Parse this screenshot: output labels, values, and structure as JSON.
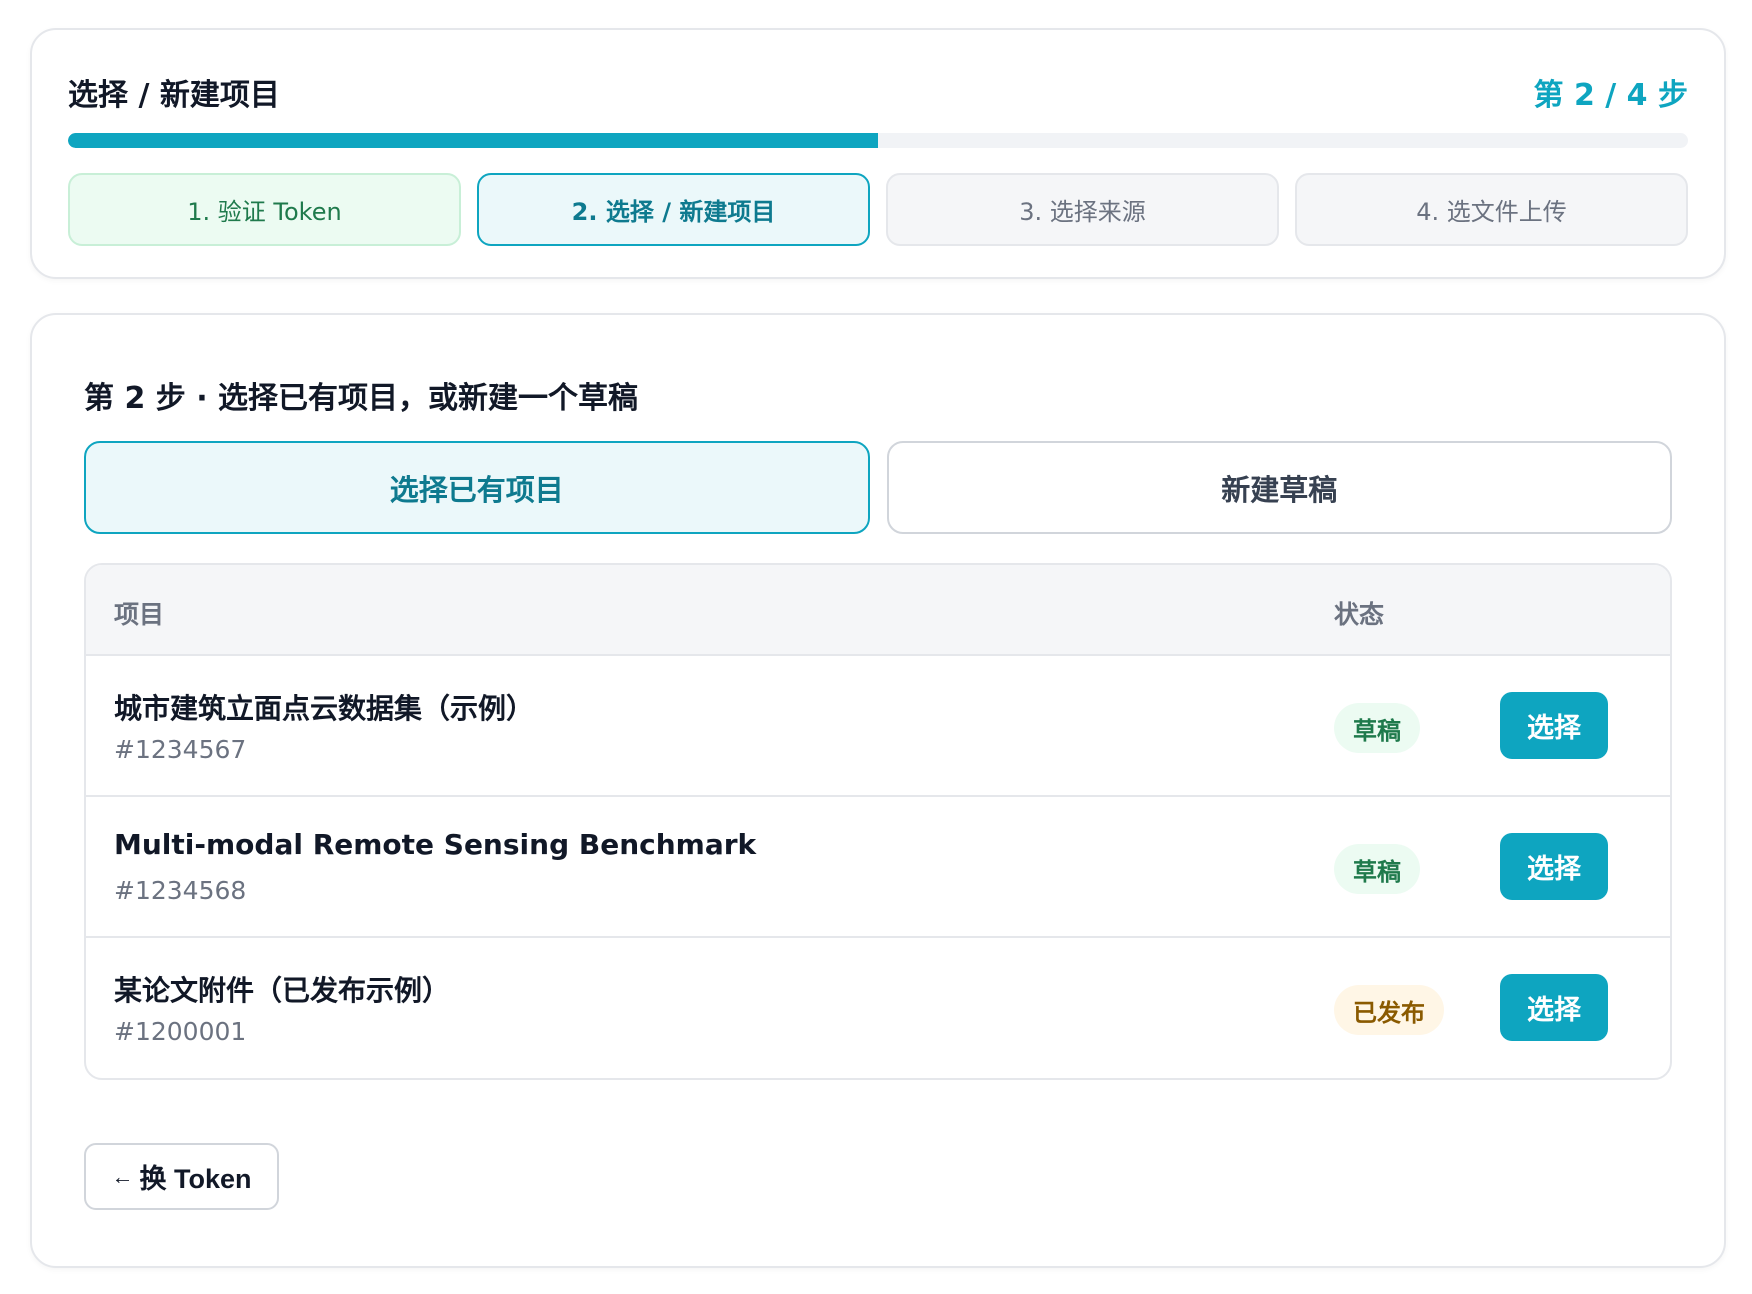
{
  "progress": {
    "title": "选择 / 新建项目",
    "step_indicator": "第 2 / 4 步",
    "fraction": 0.5,
    "steps": [
      {
        "label": "1. 验证 Token",
        "state": "done"
      },
      {
        "label": "2. 选择 / 新建项目",
        "state": "active"
      },
      {
        "label": "3. 选择来源",
        "state": "pending"
      },
      {
        "label": "4. 选文件上传",
        "state": "pending"
      }
    ]
  },
  "main": {
    "heading": "第 2 步 · 选择已有项目，或新建一个草稿",
    "tabs": [
      {
        "label": "选择已有项目",
        "active": true
      },
      {
        "label": "新建草稿",
        "active": false
      }
    ],
    "table": {
      "headers": {
        "name": "项目",
        "status": "状态"
      },
      "rows": [
        {
          "name": "城市建筑立面点云数据集（示例）",
          "id": "#1234567",
          "status": "草稿",
          "status_type": "draft",
          "action": "选择"
        },
        {
          "name": "Multi-modal Remote Sensing Benchmark",
          "id": "#1234568",
          "status": "草稿",
          "status_type": "draft",
          "action": "选择"
        },
        {
          "name": "某论文附件（已发布示例）",
          "id": "#1200001",
          "status": "已发布",
          "status_type": "published",
          "action": "选择"
        }
      ]
    },
    "back_button": {
      "arrow": "←",
      "label": "换 Token"
    }
  },
  "colors": {
    "accent": "#0ea5c0",
    "done_green": "#1f7a4c",
    "published_amber": "#8a5a00"
  }
}
